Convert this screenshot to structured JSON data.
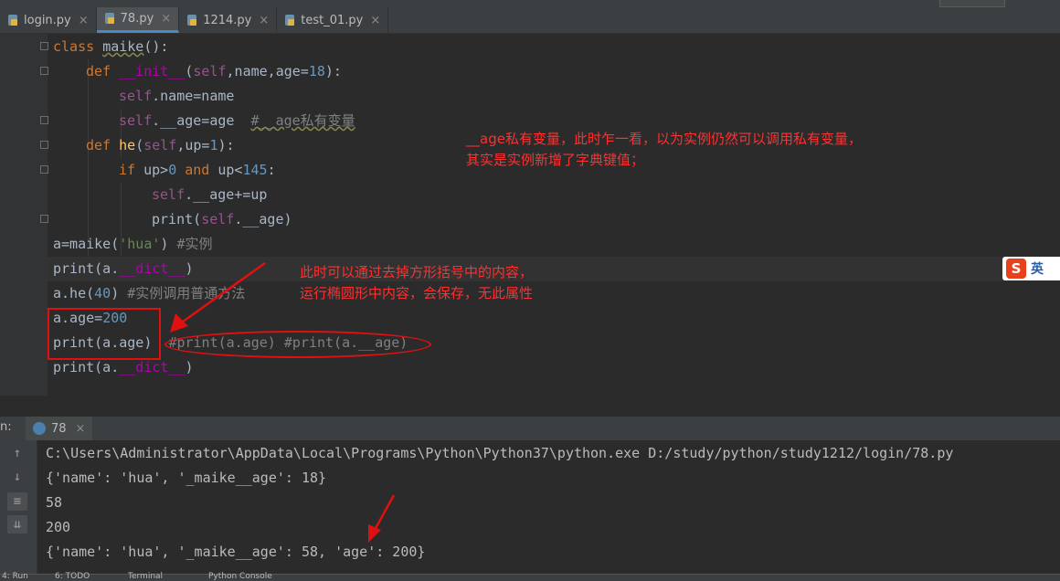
{
  "tabs": [
    {
      "label": "login.py",
      "active": false
    },
    {
      "label": "78.py",
      "active": true
    },
    {
      "label": "1214.py",
      "active": false
    },
    {
      "label": "test_01.py",
      "active": false
    }
  ],
  "tab_close_glyph": "×",
  "code": {
    "l1_kw": "class ",
    "l1_name": "maike",
    "l1_rest": "():",
    "l2_kw": "def ",
    "l2_fn": "__init__",
    "l2_p1": "(",
    "l2_self": "self",
    "l2_p2": ",name,age=",
    "l2_num": "18",
    "l2_p3": "):",
    "l3_self": "self",
    "l3_rest": ".name=name",
    "l4_self": "self",
    "l4_rest": ".__age=age  ",
    "l4_comment": "#__age私有变量",
    "l5_kw": "def ",
    "l5_fn": "he",
    "l5_p1": "(",
    "l5_self": "self",
    "l5_p2": ",up=",
    "l5_num": "1",
    "l5_p3": "):",
    "l6_kw": "if ",
    "l6_a": "up>",
    "l6_n1": "0",
    "l6_and": " and ",
    "l6_b": "up<",
    "l6_n2": "145",
    "l6_c": ":",
    "l7_self": "self",
    "l7_rest": ".__age+=up",
    "l8_a": "print(",
    "l8_self": "self",
    "l8_rest": ".__age)",
    "l9_a": "a=maike(",
    "l9_str": "'hua'",
    "l9_b": ") ",
    "l9_cm": "#实例",
    "l10_a": "print(a.",
    "l10_sp": "__dict__",
    "l10_b": ")",
    "l11_a": "a.he(",
    "l11_num": "40",
    "l11_b": ") ",
    "l11_cm": "#实例调用普通方法",
    "l12_a": "a.age=",
    "l12_num": "200",
    "l13_a": "print(a.age)  ",
    "l13_cm": "#print(a.age) #print(a.__age)",
    "l14_a": "print(a.",
    "l14_sp": "__dict__",
    "l14_b": ")"
  },
  "annotations": {
    "note1_line1": "__age私有变量，此时乍一看，以为实例仍然可以调用私有变量，",
    "note1_line2": "其实是实例新增了字典键值；",
    "note2_line1": "此时可以通过去掉方形括号中的内容，",
    "note2_line2": "运行椭圆形中内容，会保存，无此属性"
  },
  "run_panel": {
    "label": "n:",
    "tab": "78",
    "output": [
      "C:\\Users\\Administrator\\AppData\\Local\\Programs\\Python\\Python37\\python.exe D:/study/python/study1212/login/78.py",
      "{'name': 'hua', '_maike__age': 18}",
      "58",
      "200",
      "{'name': 'hua', '_maike__age': 58, 'age': 200}"
    ]
  },
  "bottom_tabs": [
    "4: Run",
    "6: TODO",
    "Terminal",
    "Python Console"
  ],
  "ime": {
    "logo": "S",
    "text": "英"
  },
  "colors": {
    "keyword": "#cc7832",
    "function": "#ffc66d",
    "self": "#94558d",
    "number": "#6897bb",
    "string": "#6a8759",
    "comment": "#808080",
    "annotation": "#ff3030"
  }
}
